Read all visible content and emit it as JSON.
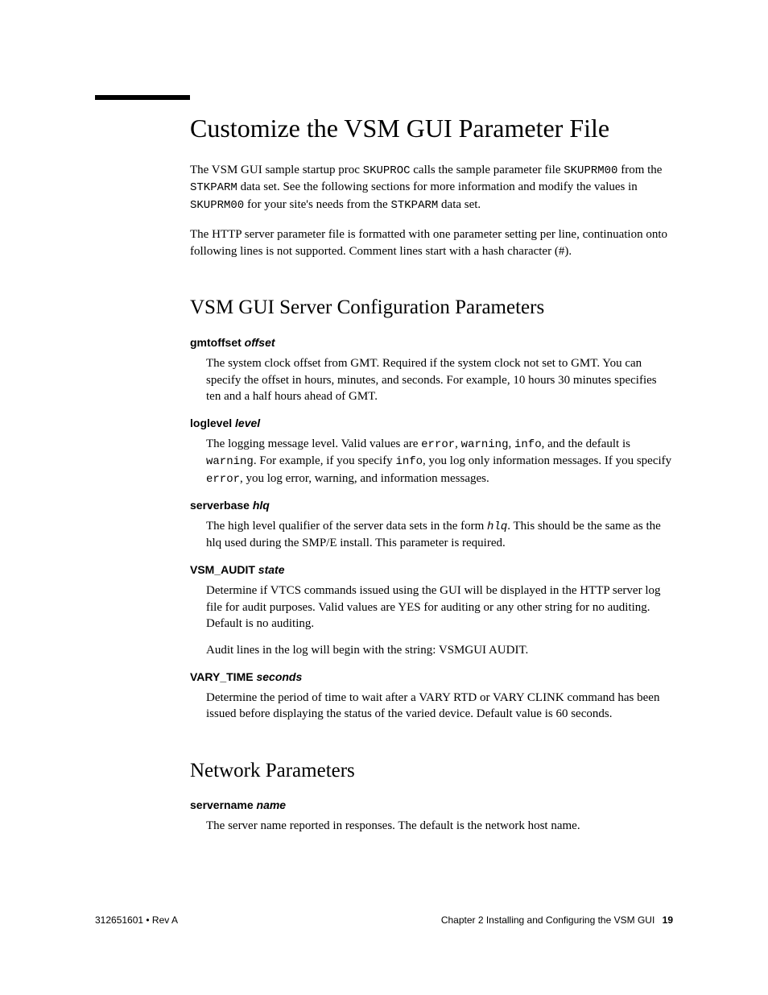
{
  "title": "Customize the VSM GUI Parameter File",
  "intro": [
    {
      "segments": [
        {
          "t": "The VSM GUI sample startup proc "
        },
        {
          "t": "SKUPROC",
          "cls": "mono"
        },
        {
          "t": " calls the sample parameter file "
        },
        {
          "t": "SKUPRM00",
          "cls": "mono"
        },
        {
          "t": " from the "
        },
        {
          "t": "STKPARM",
          "cls": "mono"
        },
        {
          "t": " data set. See the following sections for more information and modify the values in "
        },
        {
          "t": "SKUPRM00",
          "cls": "mono"
        },
        {
          "t": " for your site's needs from the "
        },
        {
          "t": "STKPARM",
          "cls": "mono"
        },
        {
          "t": " data set."
        }
      ]
    },
    {
      "segments": [
        {
          "t": "The HTTP server parameter file is formatted with one parameter setting per line, continuation onto following lines is not supported.   Comment lines start with a hash character (#)."
        }
      ]
    }
  ],
  "sections": [
    {
      "heading": "VSM GUI Server Configuration Parameters",
      "params": [
        {
          "name": "gmtoffset",
          "arg": "offset",
          "paras": [
            {
              "segments": [
                {
                  "t": "The system clock offset from GMT. Required if the system clock not set to GMT. You can specify the offset in hours, minutes, and seconds. For example, 10 hours 30 minutes specifies ten and a half hours ahead of GMT."
                }
              ]
            }
          ]
        },
        {
          "name": "loglevel",
          "arg": "level",
          "paras": [
            {
              "segments": [
                {
                  "t": "The logging message level. Valid values are "
                },
                {
                  "t": "error",
                  "cls": "mono"
                },
                {
                  "t": ", "
                },
                {
                  "t": "warning",
                  "cls": "mono"
                },
                {
                  "t": ", "
                },
                {
                  "t": "info",
                  "cls": "mono"
                },
                {
                  "t": ", and the default is "
                },
                {
                  "t": "warning",
                  "cls": "mono"
                },
                {
                  "t": ". For example, if you specify "
                },
                {
                  "t": "info",
                  "cls": "mono"
                },
                {
                  "t": ", you log only information messages. If you specify  "
                },
                {
                  "t": "error",
                  "cls": "mono"
                },
                {
                  "t": ", you log error, warning, and information messages."
                }
              ]
            }
          ]
        },
        {
          "name": "serverbase",
          "arg": "hlq",
          "paras": [
            {
              "segments": [
                {
                  "t": "The high level qualifier of the server data sets in the form "
                },
                {
                  "t": "hlq",
                  "cls": "monoit"
                },
                {
                  "t": ". This should be the same as the hlq used during the SMP/E install. This parameter is required."
                }
              ]
            }
          ]
        },
        {
          "name": "VSM_AUDIT",
          "arg": "state",
          "paras": [
            {
              "segments": [
                {
                  "t": "Determine if VTCS commands issued using the GUI will be displayed in the HTTP server log file for audit purposes. Valid values are YES for auditing or any other string for no auditing. Default is no auditing."
                }
              ]
            },
            {
              "segments": [
                {
                  "t": "Audit lines in the log will begin with the string: VSMGUI AUDIT."
                }
              ]
            }
          ]
        },
        {
          "name": "VARY_TIME",
          "arg": "seconds",
          "paras": [
            {
              "segments": [
                {
                  "t": "Determine the period of time to wait after a VARY RTD or VARY CLINK command has been issued before displaying the status of the varied device. Default value is 60 seconds."
                }
              ]
            }
          ]
        }
      ]
    },
    {
      "heading": "Network Parameters",
      "params": [
        {
          "name": "servername",
          "arg": "name",
          "paras": [
            {
              "segments": [
                {
                  "t": "The server name reported in responses. The default is the network host name."
                }
              ]
            }
          ]
        }
      ]
    }
  ],
  "footer": {
    "left": "312651601 • Rev A",
    "right_text": "Chapter 2 Installing and Configuring the VSM GUI",
    "page": "19"
  }
}
